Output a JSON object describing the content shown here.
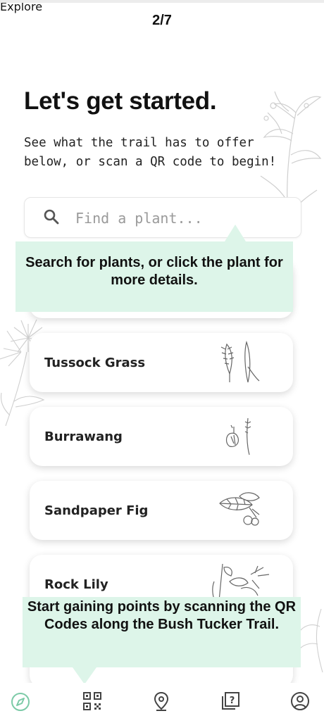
{
  "onboarding": {
    "step": "2/7",
    "title": "Let's get started.",
    "subtitle": "See what the trail has to offer\nbelow, or scan a QR code to begin!"
  },
  "search": {
    "placeholder": "Find a plant...",
    "icon": "search-icon"
  },
  "plants": [
    {
      "name": "Tussock Grass",
      "image": "tussock-grass-illustration"
    },
    {
      "name": "Burrawang",
      "image": "burrawang-illustration"
    },
    {
      "name": "Sandpaper Fig",
      "image": "sandpaper-fig-illustration"
    },
    {
      "name": "Rock Lily",
      "image": "rock-lily-illustration"
    }
  ],
  "tooltips": {
    "search_tip": "Search for plants, or click the plant for more details.",
    "scan_tip": "Start gaining points by scanning the QR Codes along the Bush Tucker Trail."
  },
  "nav": {
    "explore_label": "Explore",
    "active_color": "#7ccaa7",
    "items": [
      "compass-icon",
      "qr-code-icon",
      "location-pin-icon",
      "quiz-icon",
      "profile-icon"
    ]
  },
  "colors": {
    "tooltip_bg": "#ddf5e9",
    "accent": "#7ccaa7"
  }
}
